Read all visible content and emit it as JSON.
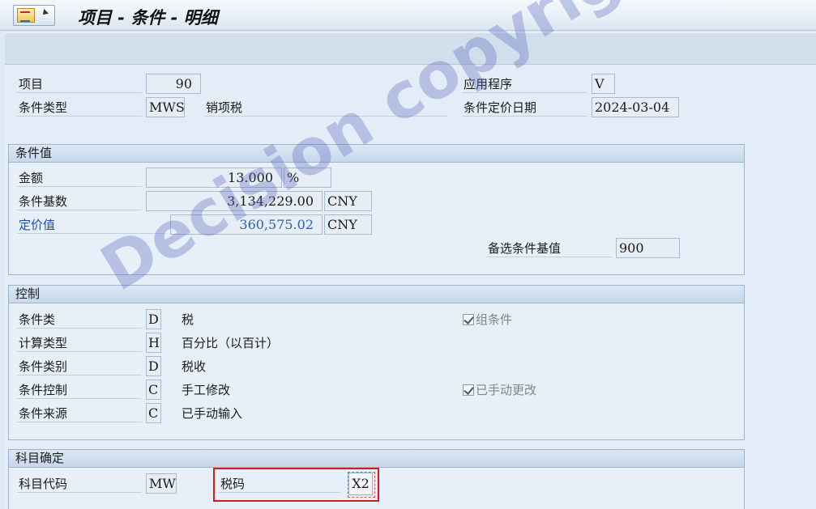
{
  "window": {
    "title": "项目 - 条件 - 明细"
  },
  "header": {
    "item_label": "项目",
    "item_value": "90",
    "cond_type_label": "条件类型",
    "cond_type_value": "MWSI",
    "cond_type_desc": "销项税",
    "application_label": "应用程序",
    "application_value": "V",
    "pricing_date_label": "条件定价日期",
    "pricing_date_value": "2024-03-04"
  },
  "condition_values": {
    "title": "条件值",
    "amount_label": "金额",
    "amount_value": "13.000",
    "amount_unit": "%",
    "base_label": "条件基数",
    "base_value": "3,134,229.00",
    "base_currency": "CNY",
    "pricing_value_label": "定价值",
    "pricing_value": "360,575.02",
    "pricing_currency": "CNY",
    "alt_base_label": "备选条件基值",
    "alt_base_value": "900"
  },
  "control": {
    "title": "控制",
    "rows": [
      {
        "label": "条件类",
        "code": "D",
        "desc": "税"
      },
      {
        "label": "计算类型",
        "code": "H",
        "desc": "百分比（以百计）"
      },
      {
        "label": "条件类别",
        "code": "D",
        "desc": "税收"
      },
      {
        "label": "条件控制",
        "code": "C",
        "desc": "手工修改"
      },
      {
        "label": "条件来源",
        "code": "C",
        "desc": "已手动输入"
      }
    ],
    "group_condition_label": "组条件",
    "group_condition_checked": true,
    "manually_changed_label": "已手动更改",
    "manually_changed_checked": true
  },
  "account_determination": {
    "title": "科目确定",
    "account_key_label": "科目代码",
    "account_key_value": "MWS",
    "tax_code_label": "税码",
    "tax_code_value": "X2"
  },
  "watermark": "Decision copyright"
}
